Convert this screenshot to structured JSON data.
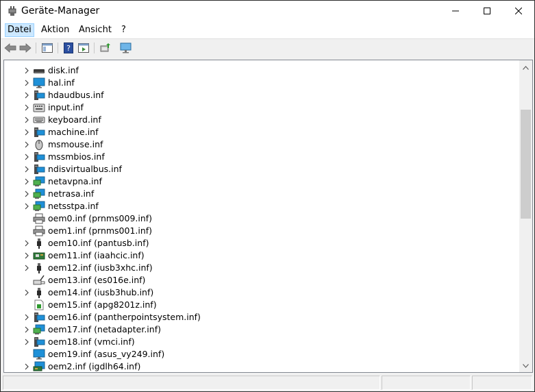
{
  "window": {
    "title": "Geräte-Manager",
    "controls": {
      "minimize_icon": "minimize-icon",
      "maximize_icon": "maximize-icon",
      "close_icon": "close-icon"
    }
  },
  "menu": {
    "items": [
      "Datei",
      "Aktion",
      "Ansicht",
      "?"
    ],
    "active": "Datei"
  },
  "toolbar": {
    "buttons": [
      "back-arrow-icon",
      "forward-arrow-icon",
      "show-hide-console-tree-icon",
      "help-icon",
      "properties-pane-icon",
      "update-driver-icon",
      "monitor-scan-icon"
    ]
  },
  "tree": {
    "rows": [
      {
        "label": "disk.inf",
        "icon": "disk-drive-icon",
        "expandable": true
      },
      {
        "label": "hal.inf",
        "icon": "monitor-icon",
        "expandable": true
      },
      {
        "label": "hdaudbus.inf",
        "icon": "system-device-icon",
        "expandable": true
      },
      {
        "label": "input.inf",
        "icon": "hid-icon",
        "expandable": true
      },
      {
        "label": "keyboard.inf",
        "icon": "keyboard-icon",
        "expandable": true
      },
      {
        "label": "machine.inf",
        "icon": "system-device-icon",
        "expandable": true
      },
      {
        "label": "msmouse.inf",
        "icon": "mouse-icon",
        "expandable": true
      },
      {
        "label": "mssmbios.inf",
        "icon": "system-device-icon",
        "expandable": true
      },
      {
        "label": "ndisvirtualbus.inf",
        "icon": "system-device-icon",
        "expandable": true
      },
      {
        "label": "netavpna.inf",
        "icon": "network-adapter-icon",
        "expandable": true
      },
      {
        "label": "netrasa.inf",
        "icon": "network-adapter-icon",
        "expandable": true
      },
      {
        "label": "netsstpa.inf",
        "icon": "network-adapter-icon",
        "expandable": true
      },
      {
        "label": "oem0.inf (prnms009.inf)",
        "icon": "printer-icon",
        "expandable": false
      },
      {
        "label": "oem1.inf (prnms001.inf)",
        "icon": "printer-icon",
        "expandable": false
      },
      {
        "label": "oem10.inf (pantusb.inf)",
        "icon": "usb-icon",
        "expandable": true
      },
      {
        "label": "oem11.inf (iaahcic.inf)",
        "icon": "storage-controller-icon",
        "expandable": true
      },
      {
        "label": "oem12.inf (iusb3xhc.inf)",
        "icon": "usb-icon",
        "expandable": true
      },
      {
        "label": "oem13.inf (es016e.inf)",
        "icon": "software-device-icon",
        "expandable": false
      },
      {
        "label": "oem14.inf (iusb3hub.inf)",
        "icon": "usb-icon",
        "expandable": true
      },
      {
        "label": "oem15.inf (apg8201z.inf)",
        "icon": "software-component-icon",
        "expandable": false
      },
      {
        "label": "oem16.inf (pantherpointsystem.inf)",
        "icon": "system-device-icon",
        "expandable": true
      },
      {
        "label": "oem17.inf (netadapter.inf)",
        "icon": "network-adapter-icon",
        "expandable": true
      },
      {
        "label": "oem18.inf (vmci.inf)",
        "icon": "system-device-icon",
        "expandable": true
      },
      {
        "label": "oem19.inf (asus_vy249.inf)",
        "icon": "monitor-icon",
        "expandable": false
      },
      {
        "label": "oem2.inf (igdlh64.inf)",
        "icon": "display-adapter-icon",
        "expandable": true
      }
    ]
  },
  "scrollbar": {
    "up_icon": "scroll-up-icon",
    "down_icon": "scroll-down-icon"
  },
  "statusbar": {
    "panels": [
      "",
      "",
      ""
    ]
  }
}
